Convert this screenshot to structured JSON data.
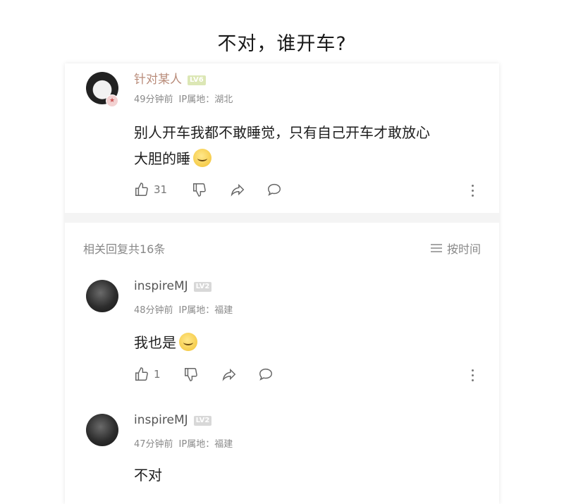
{
  "caption": "不对，谁开车?",
  "comments": [
    {
      "username": "针对某人",
      "level": "LV6",
      "time": "49分钟前",
      "ip": "IP属地：湖北",
      "text_line1": "别人开车我都不敢睡觉，只有自己开车才敢放心",
      "text_line2": "大胆的睡",
      "emoji": "laughing-emoji",
      "likes": "31"
    },
    {
      "username": "inspireMJ",
      "level": "LV2",
      "time": "48分钟前",
      "ip": "IP属地：福建",
      "text": "我也是",
      "emoji": "laughing-emoji",
      "likes": "1"
    },
    {
      "username": "inspireMJ",
      "level": "LV2",
      "time": "47分钟前",
      "ip": "IP属地：福建",
      "text": "不对"
    }
  ],
  "replies_header": {
    "label": "相关回复共16条",
    "sort_label": "按时间"
  }
}
